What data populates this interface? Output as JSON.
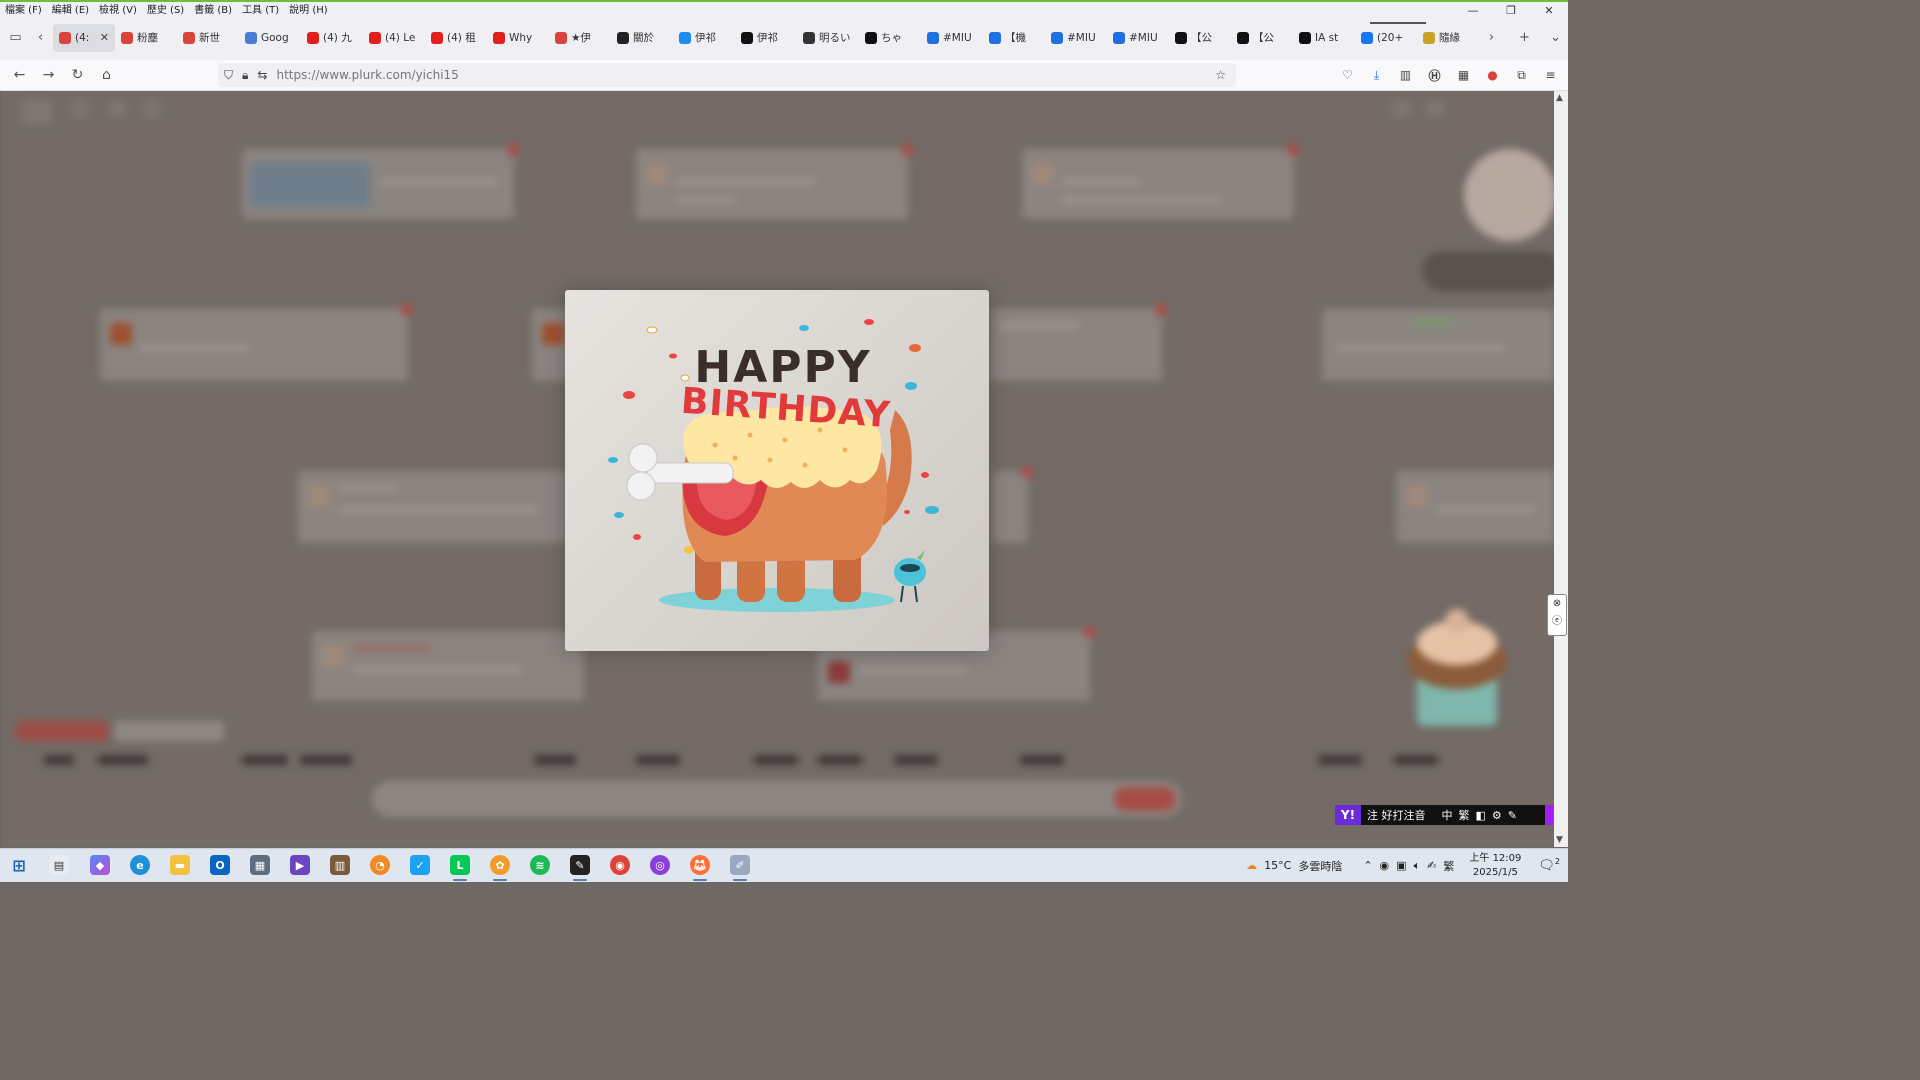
{
  "menubar": {
    "items": [
      "檔案 (F)",
      "編輯 (E)",
      "檢視 (V)",
      "歷史 (S)",
      "書籤 (B)",
      "工具 (T)",
      "說明 (H)"
    ],
    "window_controls": [
      "—",
      "❐",
      "✕"
    ]
  },
  "tabs": [
    {
      "label": "(4:",
      "icon_color": "#d9443c",
      "icon": "plurk-icon",
      "active": true
    },
    {
      "label": "粉塵",
      "icon_color": "#d9443c",
      "icon": "plurk-icon"
    },
    {
      "label": "新世",
      "icon_color": "#d9443c",
      "icon": "plurk-icon"
    },
    {
      "label": "Goog",
      "icon_color": "#4a7bd8",
      "icon": "google-translate-icon"
    },
    {
      "label": "(4) 九",
      "icon_color": "#e32020",
      "icon": "youtube-icon"
    },
    {
      "label": "(4) Le",
      "icon_color": "#e32020",
      "icon": "youtube-icon"
    },
    {
      "label": "(4) 租",
      "icon_color": "#e32020",
      "icon": "youtube-icon"
    },
    {
      "label": "Why",
      "icon_color": "#e32020",
      "icon": "youtube-icon"
    },
    {
      "label": "★伊",
      "icon_color": "#d9443c",
      "icon": "plurk-icon"
    },
    {
      "label": "關於",
      "icon_color": "#222222",
      "icon": "star-site-icon"
    },
    {
      "label": "伊祁",
      "icon_color": "#1d8cf0",
      "icon": "bluesky-icon"
    },
    {
      "label": "伊祁",
      "icon_color": "#111111",
      "icon": "x-icon"
    },
    {
      "label": "明るい",
      "icon_color": "#333333",
      "icon": "threads-icon"
    },
    {
      "label": "ちゃ",
      "icon_color": "#111111",
      "icon": "x-icon"
    },
    {
      "label": "#MIU",
      "icon_color": "#1f6fe0",
      "icon": "pixiv-icon"
    },
    {
      "label": "【機",
      "icon_color": "#1f6fe0",
      "icon": "site-icon"
    },
    {
      "label": "#MIU",
      "icon_color": "#1f6fe0",
      "icon": "pixiv-icon"
    },
    {
      "label": "#MIU",
      "icon_color": "#1f6fe0",
      "icon": "pixiv-icon"
    },
    {
      "label": "【公",
      "icon_color": "#111111",
      "icon": "x-icon"
    },
    {
      "label": "【公",
      "icon_color": "#111111",
      "icon": "x-icon"
    },
    {
      "label": "IA st",
      "icon_color": "#111111",
      "icon": "x-icon"
    },
    {
      "label": "(20+",
      "icon_color": "#1877f2",
      "icon": "facebook-icon"
    },
    {
      "label": "隨緣",
      "icon_color": "#c9a227",
      "icon": "site-icon"
    }
  ],
  "navbar": {
    "url_domain": "https://www.plurk.com",
    "url_path": "/yichi15"
  },
  "modal": {
    "title_top": "HAPPY",
    "title_bottom": "BIRTHDAY"
  },
  "ime": {
    "logo": "Y!",
    "label": "注 好打注音",
    "mode": "中",
    "charset": "繁"
  },
  "taskbar": {
    "weather": "15°C",
    "weather_desc": "多雲時陰",
    "lang": "繁",
    "time": "上午 12:09",
    "date": "2025/1/5",
    "notification_count": "2"
  }
}
